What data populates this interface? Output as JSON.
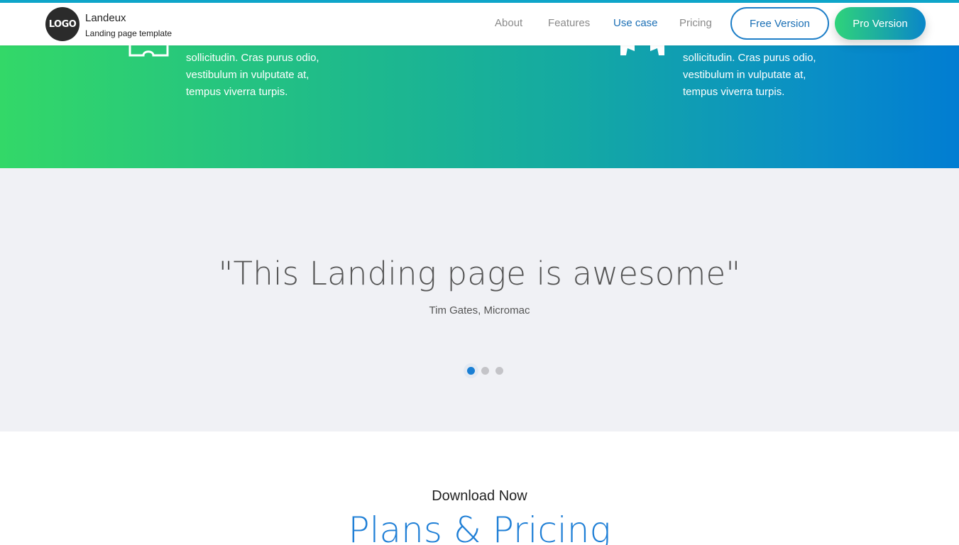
{
  "header": {
    "logo_text": "LOGO",
    "brand_name": "Landeux",
    "brand_tagline": "Landing page template",
    "nav": [
      {
        "label": "About"
      },
      {
        "label": "Features"
      },
      {
        "label": "Use case"
      },
      {
        "label": "Pricing"
      }
    ],
    "active_nav": "Use case",
    "free_button": "Free Version",
    "pro_button": "Pro Version"
  },
  "features": {
    "left": {
      "icon": "puzzle-outline-icon",
      "lines": [
        "sollicitudin. Cras purus odio,",
        "vestibulum in vulputate at,",
        "tempus viverra turpis."
      ]
    },
    "right": {
      "icon": "puzzle-solid-icon",
      "lines": [
        "sollicitudin. Cras purus odio,",
        "vestibulum in vulputate at,",
        "tempus viverra turpis."
      ]
    }
  },
  "testimonial": {
    "quote": "\"This Landing page is awesome\"",
    "author": "Tim Gates, Micromac",
    "active_slide": 1,
    "slide_count": 3
  },
  "pricing": {
    "kicker": "Download Now",
    "title": "Plans & Pricing"
  },
  "colors": {
    "accent_blue": "#1f7fd6",
    "gradient_start": "#33d868",
    "gradient_end": "#017dd2",
    "testimonial_bg": "#f0f1f5"
  }
}
